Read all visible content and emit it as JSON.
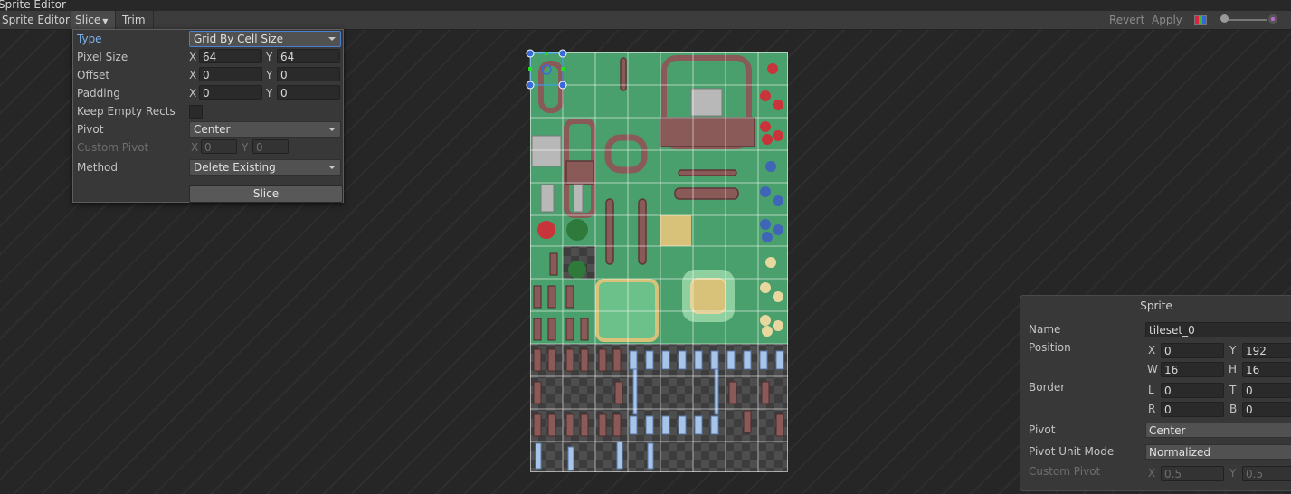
{
  "window": {
    "title": "Sprite Editor"
  },
  "toolbar": {
    "mode_label": "Sprite Editor",
    "slice_label": "Slice",
    "trim_label": "Trim",
    "revert_label": "Revert",
    "apply_label": "Apply"
  },
  "slice_panel": {
    "type_label": "Type",
    "type_value": "Grid By Cell Size",
    "pixel_size_label": "Pixel Size",
    "pixel_size": {
      "x": "64",
      "y": "64"
    },
    "offset_label": "Offset",
    "offset": {
      "x": "0",
      "y": "0"
    },
    "padding_label": "Padding",
    "padding": {
      "x": "0",
      "y": "0"
    },
    "keep_empty_label": "Keep Empty Rects",
    "keep_empty": false,
    "pivot_label": "Pivot",
    "pivot_value": "Center",
    "custom_pivot_label": "Custom Pivot",
    "custom_pivot": {
      "x": "0",
      "y": "0"
    },
    "method_label": "Method",
    "method_value": "Delete Existing",
    "slice_button": "Slice",
    "axis_x": "X",
    "axis_y": "Y"
  },
  "sprite_panel": {
    "title": "Sprite",
    "name_label": "Name",
    "name_value": "tileset_0",
    "position_label": "Position",
    "position": {
      "x": "0",
      "y": "192",
      "w": "16",
      "h": "16"
    },
    "border_label": "Border",
    "border": {
      "l": "0",
      "t": "0",
      "r": "0",
      "b": "0"
    },
    "pivot_label": "Pivot",
    "pivot_value": "Center",
    "pivot_unit_label": "Pivot Unit Mode",
    "pivot_unit_value": "Normalized",
    "custom_pivot_label": "Custom Pivot",
    "custom_pivot": {
      "x": "0.5",
      "y": "0.5"
    },
    "axis": {
      "x": "X",
      "y": "Y",
      "w": "W",
      "h": "H",
      "l": "L",
      "t": "T",
      "r": "R",
      "b": "B"
    }
  },
  "colors": {
    "grass": "#4aa06c",
    "dirt": "#8a5a58",
    "sand": "#d8c27a",
    "selection": "#3aa0ff",
    "handle": "#22dd22"
  },
  "icons": [
    "dropdown-arrow-icon",
    "rgb-channel-icon",
    "zoom-slider-icon",
    "mipmap-icon"
  ]
}
